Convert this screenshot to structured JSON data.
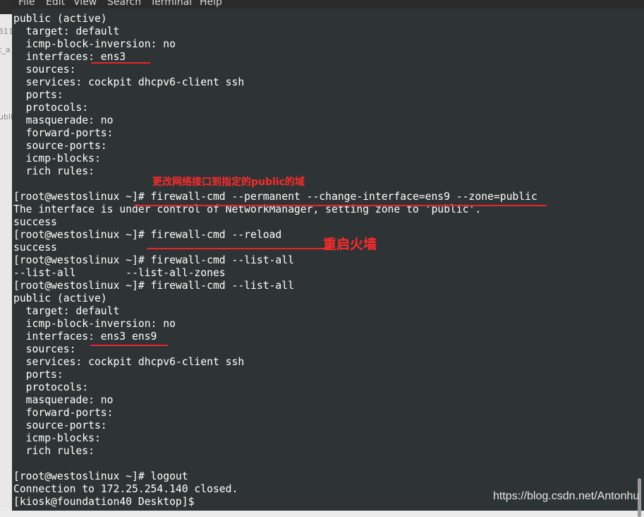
{
  "menubar": {
    "items": [
      "File",
      "Edit",
      "View",
      "Search",
      "Terminal",
      "Help"
    ]
  },
  "left_fragments": [
    "611",
    "t_a",
    "ubli"
  ],
  "terminal": {
    "lines": [
      "public (active)",
      "  target: default",
      "  icmp-block-inversion: no",
      "  interfaces: ens3",
      "  sources: ",
      "  services: cockpit dhcpv6-client ssh",
      "  ports: ",
      "  protocols: ",
      "  masquerade: no",
      "  forward-ports: ",
      "  source-ports: ",
      "  icmp-blocks: ",
      "  rich rules: ",
      "\t",
      "",
      "[root@westoslinux ~]# firewall-cmd --permanent --change-interface=ens9 --zone=public",
      "The interface is under control of NetworkManager, setting zone to 'public'.",
      "success",
      "[root@westoslinux ~]# firewall-cmd --reload",
      "success",
      "[root@westoslinux ~]# firewall-cmd --list-all",
      "--list-all        --list-all-zones",
      "[root@westoslinux ~]# firewall-cmd --list-all",
      "public (active)",
      "  target: default",
      "  icmp-block-inversion: no",
      "  interfaces: ens3 ens9",
      "  sources: ",
      "  services: cockpit dhcpv6-client ssh",
      "  ports: ",
      "  protocols: ",
      "  masquerade: no",
      "  forward-ports: ",
      "  source-ports: ",
      "  icmp-blocks: ",
      "  rich rules: ",
      "\t",
      "[root@westoslinux ~]# logout",
      "Connection to 172.25.254.140 closed.",
      "[kiosk@foundation40 Desktop]$ "
    ]
  },
  "annotations": {
    "change_interface": "更改网络接口到指定的public的域",
    "restart_firewall": "重启火墙"
  },
  "watermark": "https://blog.csdn.net/Antonhu",
  "colors": {
    "terminal_bg": "#2e3436",
    "text": "#ffffff",
    "annotation_red": "#ff2a2a"
  }
}
